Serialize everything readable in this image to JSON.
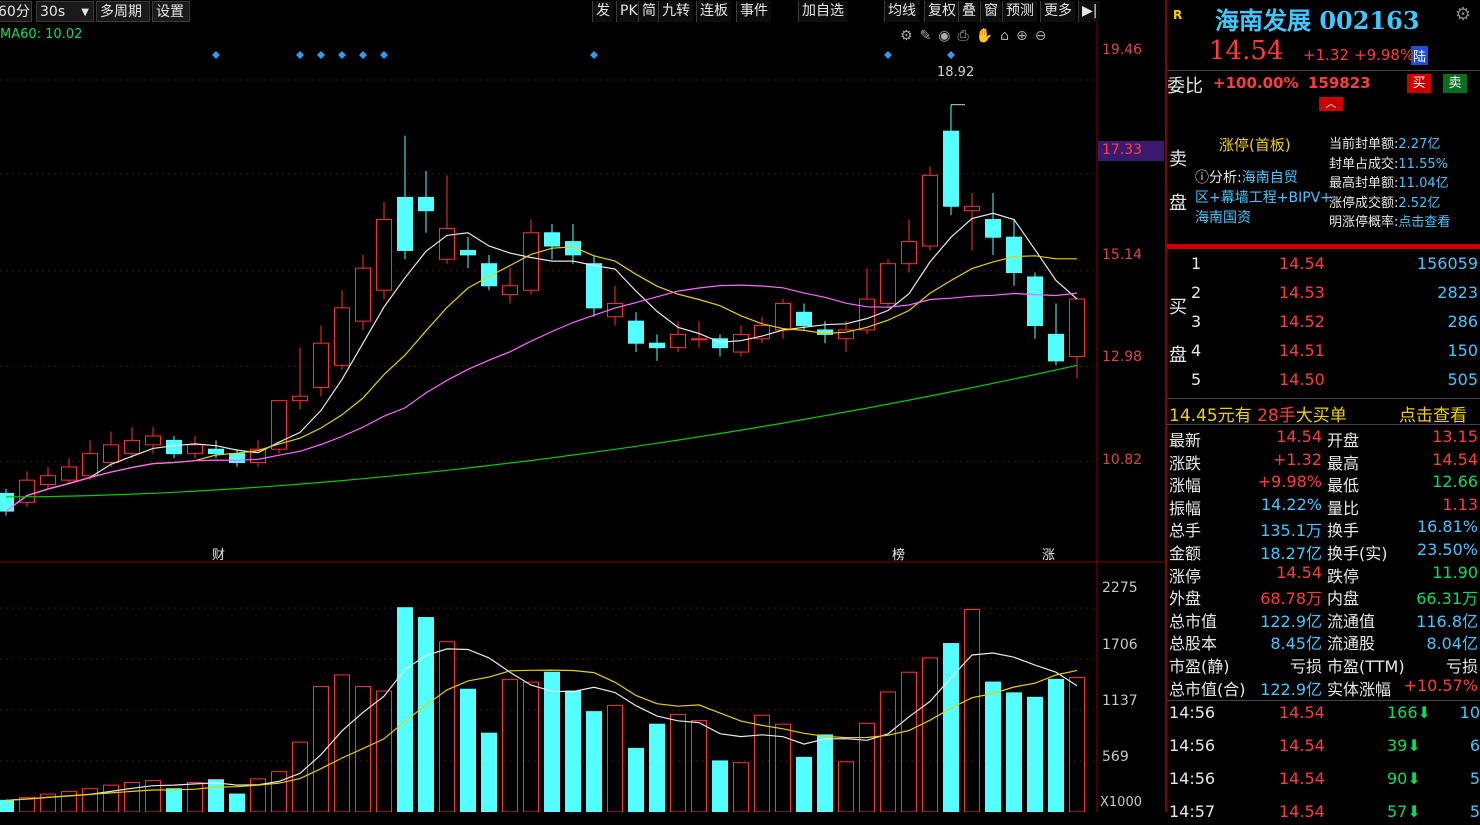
{
  "toolbar": {
    "period": "60分",
    "interval": "30s",
    "multi_period": "多周期",
    "settings": "设置",
    "right_items": [
      "发",
      "PK",
      "简",
      "九转",
      "连板",
      "事件",
      "加自选",
      "均线",
      "复权",
      "叠",
      "窗",
      "预测",
      "更多"
    ]
  },
  "indicator_label": "MA60: 10.02",
  "price_axis": [
    "19.46",
    "17.33",
    "15.14",
    "12.98",
    "10.82"
  ],
  "current_price_tag": "17.33",
  "high_annotation": "18.92",
  "event_markers": [
    "财",
    "榜",
    "涨"
  ],
  "volume_axis": [
    "2275",
    "1706",
    "1137",
    "569"
  ],
  "volume_unit": "X1000",
  "chart_data": {
    "type": "candlestick",
    "price_ylim": [
      9.0,
      20.5
    ],
    "candles": [
      {
        "o": 10.1,
        "c": 9.7,
        "h": 10.2,
        "l": 9.6
      },
      {
        "o": 9.9,
        "c": 10.4,
        "h": 10.6,
        "l": 9.8
      },
      {
        "o": 10.3,
        "c": 10.5,
        "h": 10.7,
        "l": 10.2
      },
      {
        "o": 10.4,
        "c": 10.7,
        "h": 10.9,
        "l": 10.3
      },
      {
        "o": 10.5,
        "c": 11.0,
        "h": 11.3,
        "l": 10.4
      },
      {
        "o": 10.8,
        "c": 11.2,
        "h": 11.5,
        "l": 10.7
      },
      {
        "o": 11.0,
        "c": 11.3,
        "h": 11.6,
        "l": 10.9
      },
      {
        "o": 11.2,
        "c": 11.4,
        "h": 11.6,
        "l": 11.0
      },
      {
        "o": 11.3,
        "c": 11.0,
        "h": 11.4,
        "l": 10.9
      },
      {
        "o": 11.0,
        "c": 11.2,
        "h": 11.4,
        "l": 10.9
      },
      {
        "o": 11.1,
        "c": 11.0,
        "h": 11.3,
        "l": 10.9
      },
      {
        "o": 11.0,
        "c": 10.8,
        "h": 11.1,
        "l": 10.7
      },
      {
        "o": 10.8,
        "c": 11.1,
        "h": 11.3,
        "l": 10.7
      },
      {
        "o": 11.1,
        "c": 12.2,
        "h": 12.2,
        "l": 11.0
      },
      {
        "o": 12.2,
        "c": 12.3,
        "h": 13.4,
        "l": 12.0
      },
      {
        "o": 12.5,
        "c": 13.5,
        "h": 13.9,
        "l": 12.3
      },
      {
        "o": 13.0,
        "c": 14.3,
        "h": 14.7,
        "l": 12.9
      },
      {
        "o": 14.0,
        "c": 15.2,
        "h": 15.5,
        "l": 13.8
      },
      {
        "o": 14.7,
        "c": 16.3,
        "h": 16.7,
        "l": 14.5
      },
      {
        "o": 16.8,
        "c": 15.6,
        "h": 18.2,
        "l": 15.4
      },
      {
        "o": 16.8,
        "c": 16.5,
        "h": 17.4,
        "l": 16.0
      },
      {
        "o": 15.4,
        "c": 16.1,
        "h": 17.3,
        "l": 15.3
      },
      {
        "o": 15.6,
        "c": 15.5,
        "h": 15.9,
        "l": 15.2
      },
      {
        "o": 15.3,
        "c": 14.8,
        "h": 15.5,
        "l": 14.7
      },
      {
        "o": 14.6,
        "c": 14.8,
        "h": 15.2,
        "l": 14.4
      },
      {
        "o": 14.7,
        "c": 16.0,
        "h": 16.3,
        "l": 14.6
      },
      {
        "o": 16.0,
        "c": 15.7,
        "h": 16.2,
        "l": 15.4
      },
      {
        "o": 15.8,
        "c": 15.5,
        "h": 16.2,
        "l": 15.3
      },
      {
        "o": 15.3,
        "c": 14.3,
        "h": 15.5,
        "l": 14.1
      },
      {
        "o": 14.1,
        "c": 14.4,
        "h": 14.8,
        "l": 13.9
      },
      {
        "o": 14.0,
        "c": 13.5,
        "h": 14.2,
        "l": 13.3
      },
      {
        "o": 13.5,
        "c": 13.4,
        "h": 13.7,
        "l": 13.1
      },
      {
        "o": 13.4,
        "c": 13.7,
        "h": 14.0,
        "l": 13.3
      },
      {
        "o": 13.6,
        "c": 13.6,
        "h": 14.0,
        "l": 13.4
      },
      {
        "o": 13.6,
        "c": 13.4,
        "h": 13.7,
        "l": 13.2
      },
      {
        "o": 13.3,
        "c": 13.7,
        "h": 13.9,
        "l": 13.2
      },
      {
        "o": 13.6,
        "c": 13.9,
        "h": 14.1,
        "l": 13.5
      },
      {
        "o": 13.8,
        "c": 14.4,
        "h": 14.5,
        "l": 13.6
      },
      {
        "o": 14.2,
        "c": 13.9,
        "h": 14.4,
        "l": 13.8
      },
      {
        "o": 13.8,
        "c": 13.7,
        "h": 14.0,
        "l": 13.5
      },
      {
        "o": 13.6,
        "c": 13.8,
        "h": 14.0,
        "l": 13.3
      },
      {
        "o": 13.8,
        "c": 14.5,
        "h": 15.2,
        "l": 13.7
      },
      {
        "o": 14.4,
        "c": 15.3,
        "h": 15.4,
        "l": 14.3
      },
      {
        "o": 15.3,
        "c": 15.8,
        "h": 16.3,
        "l": 15.1
      },
      {
        "o": 15.7,
        "c": 17.3,
        "h": 17.5,
        "l": 15.6
      },
      {
        "o": 18.3,
        "c": 16.6,
        "h": 18.9,
        "l": 16.4
      },
      {
        "o": 16.5,
        "c": 16.6,
        "h": 16.9,
        "l": 15.6
      },
      {
        "o": 16.3,
        "c": 15.9,
        "h": 16.9,
        "l": 15.5
      },
      {
        "o": 15.9,
        "c": 15.1,
        "h": 16.3,
        "l": 14.8
      },
      {
        "o": 15.0,
        "c": 13.9,
        "h": 15.1,
        "l": 13.6
      },
      {
        "o": 13.7,
        "c": 13.1,
        "h": 14.4,
        "l": 13.0
      },
      {
        "o": 13.2,
        "c": 14.5,
        "h": 14.5,
        "l": 12.7
      }
    ],
    "volumes": [
      130,
      160,
      200,
      230,
      260,
      300,
      330,
      350,
      260,
      330,
      360,
      200,
      370,
      450,
      780,
      1400,
      1530,
      1400,
      1350,
      2280,
      2170,
      1900,
      1370,
      880,
      1480,
      1450,
      1560,
      1350,
      1120,
      1190,
      710,
      980,
      1090,
      1020,
      570,
      550,
      1080,
      980,
      610,
      860,
      560,
      990,
      1340,
      1560,
      1720,
      1880,
      2260,
      1450,
      1330,
      1280,
      1480,
      1500
    ]
  },
  "panel": {
    "badge": "R",
    "stock_name": "海南发展",
    "stock_code": "002163",
    "price": "14.54",
    "change": "+1.32",
    "change_pct": "+9.98%",
    "exchange_tag": "陆",
    "weibi_label": "委比",
    "weibi_pct": "+100.00%",
    "weibi_val": "159823",
    "buy_btn": "买",
    "sell_btn": "卖",
    "sell_side_label": [
      "卖",
      "盘"
    ],
    "limit_title": "涨停(首板)",
    "analysis_prefix": "分析:",
    "analysis_text": [
      "海南自贸",
      "区+幕墙工程+BIPV+",
      "海南国资"
    ],
    "seal_stats": [
      {
        "label": "当前封单额:",
        "value": "2.27亿"
      },
      {
        "label": "封单占成交:",
        "value": "11.55%"
      },
      {
        "label": "最高封单额:",
        "value": "11.04亿"
      },
      {
        "label": "涨停成交额:",
        "value": "2.52亿"
      },
      {
        "label": "明涨停概率:",
        "value": "点击查看"
      }
    ],
    "buy_side_label": [
      "买",
      "盘"
    ],
    "bids": [
      {
        "lvl": "1",
        "price": "14.54",
        "vol": "156059"
      },
      {
        "lvl": "2",
        "price": "14.53",
        "vol": "2823"
      },
      {
        "lvl": "3",
        "price": "14.52",
        "vol": "286"
      },
      {
        "lvl": "4",
        "price": "14.51",
        "vol": "150"
      },
      {
        "lvl": "5",
        "price": "14.50",
        "vol": "505"
      }
    ],
    "bigorder_price": "14.45",
    "bigorder_text1": "元有",
    "bigorder_qty": "28手",
    "bigorder_text2": "大买单",
    "bigorder_link": "点击查看",
    "stats": [
      {
        "l1": "最新",
        "v1": "14.54",
        "c1": "r",
        "l2": "开盘",
        "v2": "13.15",
        "c2": "r"
      },
      {
        "l1": "涨跌",
        "v1": "+1.32",
        "c1": "r",
        "l2": "最高",
        "v2": "14.54",
        "c2": "r"
      },
      {
        "l1": "涨幅",
        "v1": "+9.98%",
        "c1": "r",
        "l2": "最低",
        "v2": "12.66",
        "c2": "g"
      },
      {
        "l1": "振幅",
        "v1": "14.22%",
        "c1": "c",
        "l2": "量比",
        "v2": "1.13",
        "c2": "r"
      },
      {
        "l1": "总手",
        "v1": "135.1万",
        "c1": "c",
        "l2": "换手",
        "v2": "16.81%",
        "c2": "c"
      },
      {
        "l1": "金额",
        "v1": "18.27亿",
        "c1": "c",
        "l2": "换手(实)",
        "v2": "23.50%",
        "c2": "c"
      },
      {
        "l1": "涨停",
        "v1": "14.54",
        "c1": "r",
        "l2": "跌停",
        "v2": "11.90",
        "c2": "g"
      },
      {
        "l1": "外盘",
        "v1": "68.78万",
        "c1": "r",
        "l2": "内盘",
        "v2": "66.31万",
        "c2": "g"
      },
      {
        "l1": "总市值",
        "v1": "122.9亿",
        "c1": "c",
        "l2": "流通值",
        "v2": "116.8亿",
        "c2": "c"
      },
      {
        "l1": "总股本",
        "v1": "8.45亿",
        "c1": "c",
        "l2": "流通股",
        "v2": "8.04亿",
        "c2": "c"
      },
      {
        "l1": "市盈(静)",
        "v1": "亏损",
        "c1": "w",
        "l2": "市盈(TTM)",
        "v2": "亏损",
        "c2": "w"
      },
      {
        "l1": "总市值(合)",
        "v1": "122.9亿",
        "c1": "c",
        "l2": "实体涨幅",
        "v2": "+10.57%",
        "c2": "r"
      }
    ],
    "ticks": [
      {
        "time": "14:56",
        "price": "14.54",
        "vol": "166",
        "n": "10"
      },
      {
        "time": "14:56",
        "price": "14.54",
        "vol": "39",
        "n": "6"
      },
      {
        "time": "14:56",
        "price": "14.54",
        "vol": "90",
        "n": "5"
      },
      {
        "time": "14:57",
        "price": "14.54",
        "vol": "57",
        "n": "5"
      }
    ]
  }
}
